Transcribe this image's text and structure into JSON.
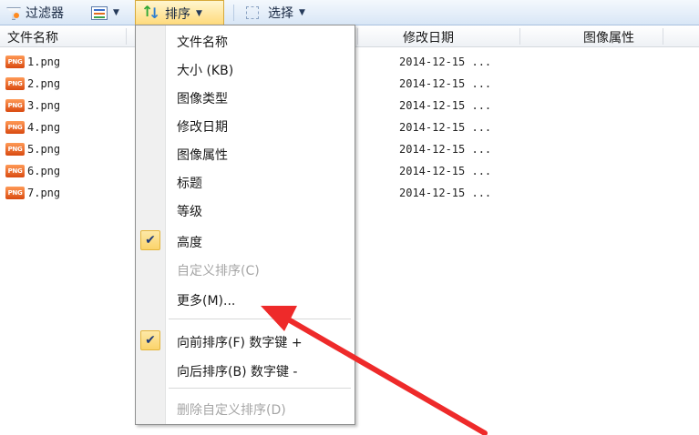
{
  "toolbar": {
    "filter_label": "过滤器",
    "sort_label": "排序",
    "select_label": "选择"
  },
  "columns": {
    "name": "文件名称",
    "date": "修改日期",
    "attributes": "图像属性"
  },
  "files": [
    {
      "icon": "PNG",
      "name": "1.png",
      "date": "2014-12-15 ..."
    },
    {
      "icon": "PNG",
      "name": "2.png",
      "date": "2014-12-15 ..."
    },
    {
      "icon": "PNG",
      "name": "3.png",
      "date": "2014-12-15 ..."
    },
    {
      "icon": "PNG",
      "name": "4.png",
      "date": "2014-12-15 ..."
    },
    {
      "icon": "PNG",
      "name": "5.png",
      "date": "2014-12-15 ..."
    },
    {
      "icon": "PNG",
      "name": "6.png",
      "date": "2014-12-15 ..."
    },
    {
      "icon": "PNG",
      "name": "7.png",
      "date": "2014-12-15 ..."
    }
  ],
  "sort_menu": {
    "items": [
      {
        "label": "文件名称"
      },
      {
        "label": "大小 (KB)"
      },
      {
        "label": "图像类型"
      },
      {
        "label": "修改日期"
      },
      {
        "label": "图像属性"
      },
      {
        "label": "标题"
      },
      {
        "label": "等级"
      },
      {
        "label": "高度"
      },
      {
        "label": "自定义排序(C)"
      },
      {
        "label": "更多(M)..."
      },
      {
        "label": "向前排序(F)  数字键 +"
      },
      {
        "label": "向后排序(B)  数字键 -"
      },
      {
        "label": "删除自定义排序(D)"
      }
    ],
    "check_glyph": "✔"
  },
  "colors": {
    "accent_arrow": "#ee2a2a",
    "toolbar_active": "#ffd978",
    "menu_check_bg": "#fbd36a"
  }
}
